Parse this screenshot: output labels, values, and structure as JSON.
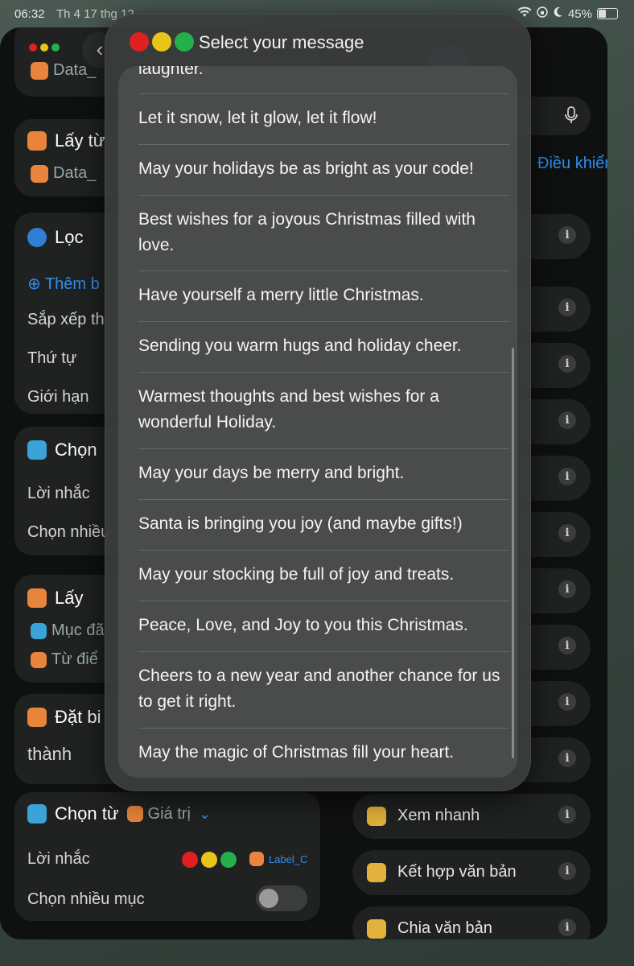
{
  "status_bar": {
    "time": "06:32",
    "date": "Th 4 17 thg 12",
    "battery": "45%"
  },
  "background": {
    "var_data": "Data_",
    "card1": {
      "title": "Lấy từ",
      "chip": "Data_"
    },
    "card2": {
      "title": "Lọc",
      "add_label": "Thêm b",
      "rows": [
        "Sắp xếp th",
        "Thứ tự",
        "Giới hạn"
      ]
    },
    "card3": {
      "title": "Chọn",
      "rows": [
        "Lời nhắc",
        "Chọn nhiều"
      ]
    },
    "card4": {
      "title": "Lấy",
      "chip1": "Mục đã",
      "chip2": "Từ điể"
    },
    "card5": {
      "title": "Đặt bi",
      "subtitle": "thành"
    },
    "card6": {
      "title": "Chọn từ",
      "chip": "Giá trị",
      "prompt_label": "Lời nhắc",
      "prompt_var": "Label_C",
      "multi_label": "Chọn nhiều mục"
    },
    "right": {
      "controls_link": "Điều khiển",
      "actions": [
        "Xem nhanh",
        "Kết hợp văn bản",
        "Chia văn bản"
      ],
      "info_glyph": "i"
    }
  },
  "dialog": {
    "title": "Select your message",
    "partial_top": "laughter.",
    "messages": [
      "Let it snow, let it glow, let it flow!",
      "May your holidays be as bright as your code!",
      "Best wishes for a joyous Christmas filled with love.",
      "Have yourself a merry little Christmas.",
      "Sending you warm hugs and holiday cheer.",
      "Warmest thoughts and best wishes for a wonderful Holiday.",
      "May your days be merry and bright.",
      "Santa is bringing you joy (and maybe gifts!)",
      "May your stocking be full of joy and treats.",
      "Peace, Love, and Joy to you this Christmas.",
      "Cheers to a new year and another chance for us to get it right.",
      "May the magic of Christmas fill your heart."
    ]
  }
}
